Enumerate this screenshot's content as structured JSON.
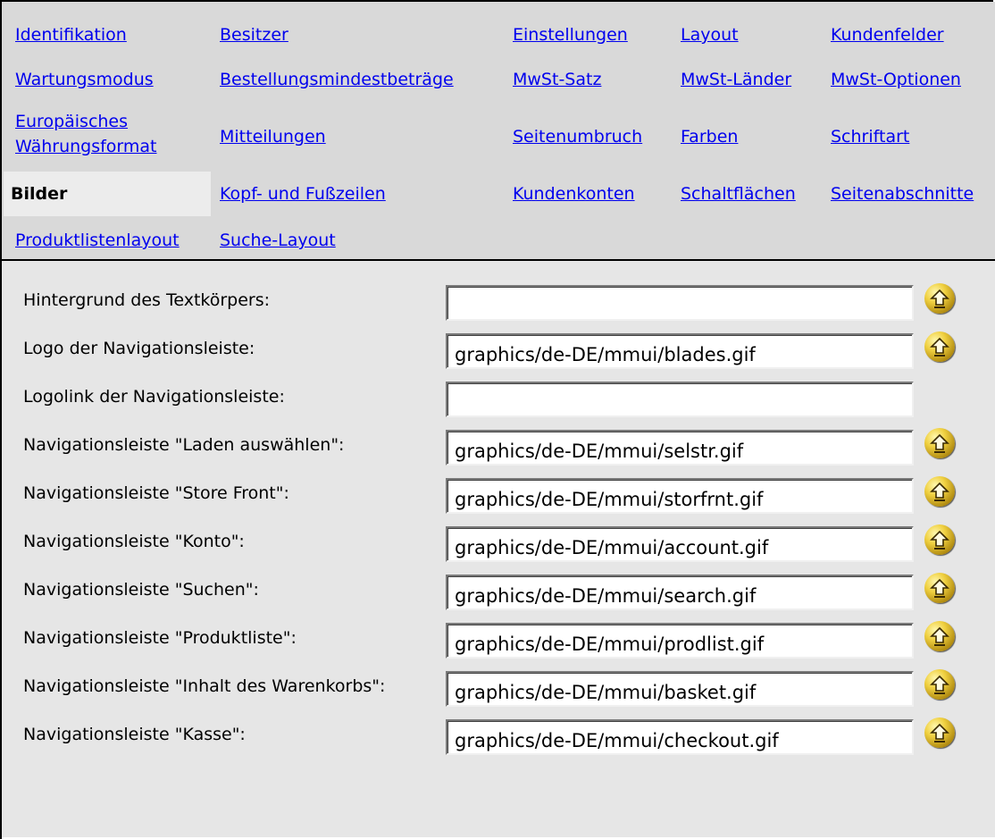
{
  "tabs": {
    "identifikation": "Identifikation",
    "besitzer": "Besitzer",
    "einstellungen": "Einstellungen",
    "layout": "Layout",
    "kundenfelder": "Kundenfelder",
    "wartungsmodus": "Wartungsmodus",
    "bestellungsmindestbetraege": "Bestellungsmindestbeträge",
    "mwst_satz": "MwSt-Satz",
    "mwst_laender": "MwSt-Länder",
    "mwst_optionen": "MwSt-Optionen",
    "europaeisches_line1": "Europäisches",
    "europaeisches_line2": "Währungsformat",
    "mitteilungen": "Mitteilungen",
    "seitenumbruch": "Seitenumbruch",
    "farben": "Farben",
    "schriftart": "Schriftart",
    "bilder": "Bilder",
    "kopf_fusszeilen": "Kopf- und Fußzeilen",
    "kundenkonten": "Kundenkonten",
    "schaltflaechen": "Schaltflächen",
    "seitenabschnitte": "Seitenabschnitte",
    "produktlistenlayout": "Produktlistenlayout",
    "suche_layout": "Suche-Layout",
    "active": "Bilder"
  },
  "form": {
    "rows": [
      {
        "label": "Hintergrund des Textkörpers:",
        "value": "",
        "upload_icon": "upload-icon"
      },
      {
        "label": "Logo der Navigationsleiste:",
        "value": "graphics/de-DE/mmui/blades.gif",
        "upload_icon": "upload-icon"
      },
      {
        "label": "Logolink der Navigationsleiste:",
        "value": ""
      },
      {
        "label": "Navigationsleiste \"Laden auswählen\":",
        "value": "graphics/de-DE/mmui/selstr.gif",
        "upload_icon": "upload-icon"
      },
      {
        "label": "Navigationsleiste \"Store Front\":",
        "value": "graphics/de-DE/mmui/storfrnt.gif",
        "upload_icon": "upload-icon"
      },
      {
        "label": "Navigationsleiste \"Konto\":",
        "value": "graphics/de-DE/mmui/account.gif",
        "upload_icon": "upload-icon"
      },
      {
        "label": "Navigationsleiste \"Suchen\":",
        "value": "graphics/de-DE/mmui/search.gif",
        "upload_icon": "upload-icon"
      },
      {
        "label": "Navigationsleiste \"Produktliste\":",
        "value": "graphics/de-DE/mmui/prodlist.gif",
        "upload_icon": "upload-icon"
      },
      {
        "label": "Navigationsleiste \"Inhalt des Warenkorbs\":",
        "value": "graphics/de-DE/mmui/basket.gif",
        "upload_icon": "upload-icon"
      },
      {
        "label": "Navigationsleiste \"Kasse\":",
        "value": "graphics/de-DE/mmui/checkout.gif",
        "upload_icon": "upload-icon"
      }
    ]
  },
  "colors": {
    "link": "#0000ee",
    "tab_bar_bg": "#d9d9d9",
    "active_tab_bg": "#ececec",
    "content_bg": "#e6e6e6",
    "upload_button": "#f0d040"
  }
}
